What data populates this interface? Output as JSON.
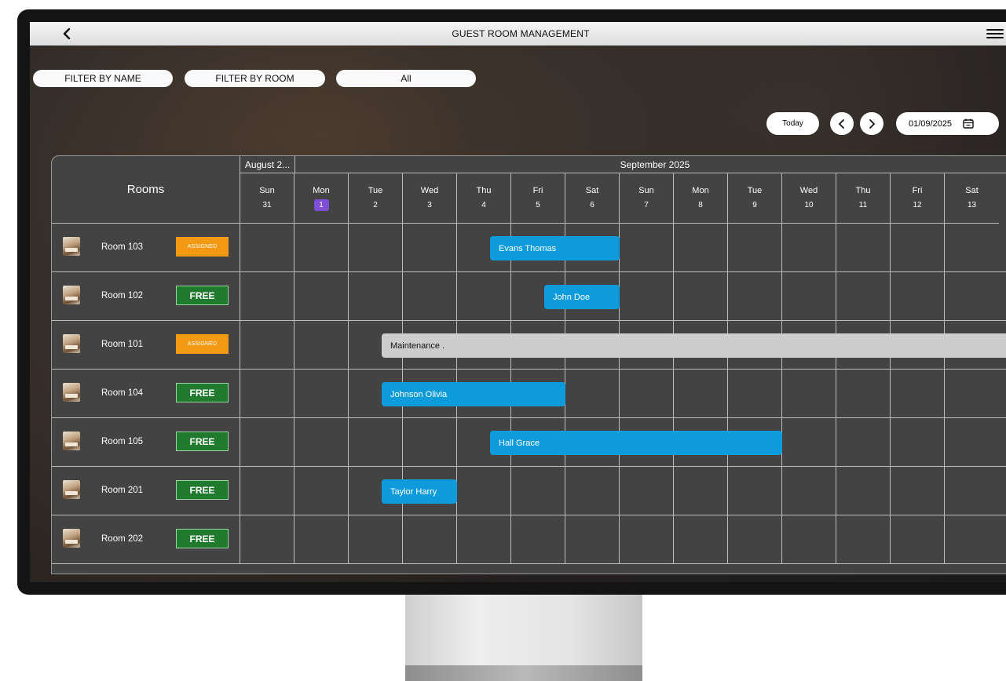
{
  "header": {
    "title": "GUEST ROOM MANAGEMENT",
    "back_icon": "chevron-left-icon",
    "menu_icon": "hamburger-menu-icon"
  },
  "filters": {
    "by_name": "FILTER BY NAME",
    "by_room": "FILTER BY ROOM",
    "status_selected": "All"
  },
  "date_controls": {
    "today_label": "Today",
    "prev_icon": "chevron-left-icon",
    "next_icon": "chevron-right-icon",
    "date_value": "01/09/2025",
    "calendar_icon": "calendar-icon"
  },
  "calendar": {
    "rooms_header": "Rooms",
    "months": [
      {
        "label": "August 2..."
      },
      {
        "label": "September 2025"
      }
    ],
    "days": [
      {
        "name": "Sun",
        "num": "31",
        "today": false
      },
      {
        "name": "Mon",
        "num": "1",
        "today": true
      },
      {
        "name": "Tue",
        "num": "2",
        "today": false
      },
      {
        "name": "Wed",
        "num": "3",
        "today": false
      },
      {
        "name": "Thu",
        "num": "4",
        "today": false
      },
      {
        "name": "Fri",
        "num": "5",
        "today": false
      },
      {
        "name": "Sat",
        "num": "6",
        "today": false
      },
      {
        "name": "Sun",
        "num": "7",
        "today": false
      },
      {
        "name": "Mon",
        "num": "8",
        "today": false
      },
      {
        "name": "Tue",
        "num": "9",
        "today": false
      },
      {
        "name": "Wed",
        "num": "10",
        "today": false
      },
      {
        "name": "Thu",
        "num": "11",
        "today": false
      },
      {
        "name": "Fri",
        "num": "12",
        "today": false
      },
      {
        "name": "Sat",
        "num": "13",
        "today": false
      }
    ],
    "rooms": [
      {
        "name": "Room 103",
        "status": "ASSIGNED",
        "status_type": "assigned"
      },
      {
        "name": "Room 102",
        "status": "FREE",
        "status_type": "free"
      },
      {
        "name": "Room 101",
        "status": "ASSIGNED",
        "status_type": "assigned"
      },
      {
        "name": "Room 104",
        "status": "FREE",
        "status_type": "free"
      },
      {
        "name": "Room 105",
        "status": "FREE",
        "status_type": "free"
      },
      {
        "name": "Room 201",
        "status": "FREE",
        "status_type": "free"
      },
      {
        "name": "Room 202",
        "status": "FREE",
        "status_type": "free"
      }
    ],
    "bookings": [
      {
        "guest": "Evans Thomas",
        "room_index": 0,
        "start_day": "4",
        "end_day": "6",
        "type": "guest"
      },
      {
        "guest": "John Doe",
        "room_index": 1,
        "start_day": "5",
        "end_day": "6",
        "type": "guest"
      },
      {
        "guest": "Maintenance .",
        "room_index": 2,
        "start_day": "2",
        "end_day": "13",
        "type": "maintenance"
      },
      {
        "guest": "Johnson Olivia",
        "room_index": 3,
        "start_day": "2",
        "end_day": "5",
        "type": "guest"
      },
      {
        "guest": "Hall Grace",
        "room_index": 4,
        "start_day": "4",
        "end_day": "9",
        "type": "guest"
      },
      {
        "guest": "Taylor Harry",
        "room_index": 5,
        "start_day": "2",
        "end_day": "3",
        "type": "guest"
      }
    ]
  },
  "colors": {
    "booking": "#0d9bdb",
    "maintenance": "#cdcdcd",
    "assigned": "#f49a12",
    "free": "#1f7a2e",
    "today_highlight": "#7e4fd6"
  }
}
